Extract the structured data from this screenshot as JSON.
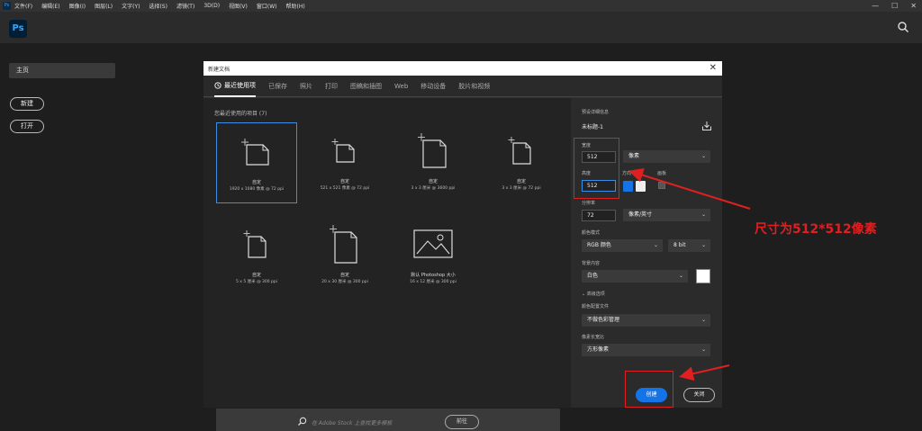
{
  "menubar": {
    "logo": "Ps",
    "items": [
      "文件(F)",
      "编辑(E)",
      "图像(I)",
      "图层(L)",
      "文字(Y)",
      "选择(S)",
      "滤镜(T)",
      "3D(D)",
      "视图(V)",
      "窗口(W)",
      "帮助(H)"
    ],
    "window_controls": [
      "—",
      "☐",
      "✕"
    ]
  },
  "app": {
    "logo": "Ps",
    "search_icon": "search-icon"
  },
  "sidebar": {
    "home": "主页",
    "new_button": "新建",
    "open_button": "打开"
  },
  "dialog": {
    "title": "新建文档",
    "close": "✕",
    "tabs": [
      "最近使用项",
      "已保存",
      "照片",
      "打印",
      "图稿和插图",
      "Web",
      "移动设备",
      "胶片和视频"
    ],
    "presets_label": "您最近使用的项目 (7)",
    "presets": [
      {
        "name": "自定",
        "info": "1920 x 1080 像素 @ 72 ppi"
      },
      {
        "name": "自定",
        "info": "521 x 521 像素 @ 72 ppi"
      },
      {
        "name": "自定",
        "info": "3 x 3 厘米 @ 3600 ppi"
      },
      {
        "name": "自定",
        "info": "3 x 3 厘米 @ 72 ppi"
      },
      {
        "name": "自定",
        "info": "5 x 5 厘米 @ 300 ppi"
      },
      {
        "name": "自定",
        "info": "20 x 30 厘米 @ 300 ppi"
      },
      {
        "name": "默认 Photoshop 大小",
        "info": "16 x 12 厘米 @ 300 ppi"
      }
    ],
    "stock": {
      "placeholder": "在 Adobe Stock 上查找更多模板",
      "go_button": "前往"
    },
    "details": {
      "section_label": "预设详细信息",
      "doc_name": "未标题-1",
      "width_label": "宽度",
      "width_value": "512",
      "width_unit": "像素",
      "height_label": "高度",
      "height_value": "512",
      "orientation_label": "方向",
      "artboard_label": "画板",
      "resolution_label": "分辨率",
      "resolution_value": "72",
      "resolution_unit": "像素/英寸",
      "color_mode_label": "颜色模式",
      "color_mode_value": "RGB 颜色",
      "bit_depth": "8 bit",
      "background_label": "背景内容",
      "background_value": "白色",
      "advanced_label": "高级选项",
      "color_profile_label": "颜色配置文件",
      "color_profile_value": "不做色彩管理",
      "pixel_aspect_label": "像素长宽比",
      "pixel_aspect_value": "方形像素",
      "create_button": "创建",
      "close_button": "关闭"
    }
  },
  "annotation": {
    "text": "尺寸为512*512像素",
    "color": "#e02020"
  }
}
